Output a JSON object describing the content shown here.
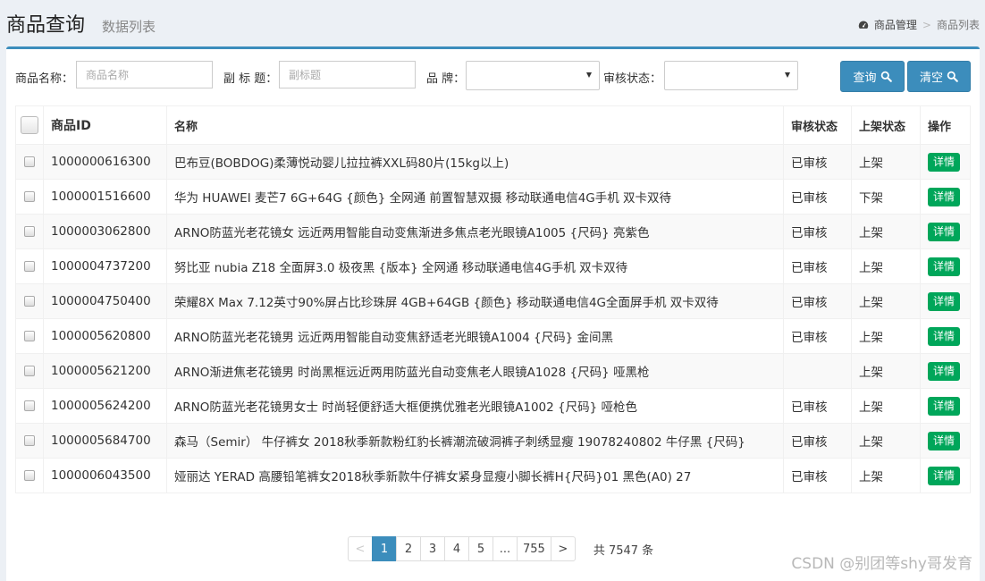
{
  "header": {
    "title": "商品查询",
    "subtitle": "数据列表",
    "breadcrumb": {
      "icon": "dashboard-icon",
      "root": "商品管理",
      "sep": ">",
      "current": "商品列表"
    }
  },
  "filters": {
    "name_label": "商品名称：",
    "name_placeholder": "商品名称",
    "subtitle_label": "副 标 题：",
    "subtitle_placeholder": "副标题",
    "brand_label": "品  牌：",
    "brand_value": "",
    "audit_label": "审核状态：",
    "audit_value": "",
    "query_button": "查询",
    "clear_button": "清空"
  },
  "table": {
    "columns": [
      "商品ID",
      "名称",
      "审核状态",
      "上架状态",
      "操作"
    ],
    "action_label": "详情",
    "rows": [
      {
        "id": "1000000616300",
        "name": "巴布豆(BOBDOG)柔薄悦动婴儿拉拉裤XXL码80片(15kg以上)",
        "audit": "已审核",
        "shelf": "上架"
      },
      {
        "id": "1000001516600",
        "name": "华为 HUAWEI 麦芒7 6G+64G {颜色} 全网通 前置智慧双摄 移动联通电信4G手机 双卡双待",
        "audit": "已审核",
        "shelf": "下架"
      },
      {
        "id": "1000003062800",
        "name": "ARNO防蓝光老花镜女 远近两用智能自动变焦渐进多焦点老光眼镜A1005 {尺码} 亮紫色",
        "audit": "已审核",
        "shelf": "上架"
      },
      {
        "id": "1000004737200",
        "name": "努比亚 nubia Z18 全面屏3.0 极夜黑 {版本} 全网通 移动联通电信4G手机 双卡双待",
        "audit": "已审核",
        "shelf": "上架"
      },
      {
        "id": "1000004750400",
        "name": "荣耀8X Max 7.12英寸90%屏占比珍珠屏 4GB+64GB {颜色} 移动联通电信4G全面屏手机 双卡双待",
        "audit": "已审核",
        "shelf": "上架"
      },
      {
        "id": "1000005620800",
        "name": "ARNO防蓝光老花镜男 远近两用智能自动变焦舒适老光眼镜A1004 {尺码} 金间黑",
        "audit": "已审核",
        "shelf": "上架"
      },
      {
        "id": "1000005621200",
        "name": "ARNO渐进焦老花镜男 时尚黑框远近两用防蓝光自动变焦老人眼镜A1028 {尺码} 哑黑枪",
        "audit": "",
        "shelf": "上架"
      },
      {
        "id": "1000005624200",
        "name": "ARNO防蓝光老花镜男女士 时尚轻便舒适大框便携优雅老光眼镜A1002 {尺码} 哑枪色",
        "audit": "已审核",
        "shelf": "上架"
      },
      {
        "id": "1000005684700",
        "name": "森马（Semir） 牛仔裤女 2018秋季新款粉红豹长裤潮流破洞裤子刺绣显瘦 19078240802 牛仔黑 {尺码}",
        "audit": "已审核",
        "shelf": "上架"
      },
      {
        "id": "1000006043500",
        "name": "娅丽达 YERAD 高腰铅笔裤女2018秋季新款牛仔裤女紧身显瘦小脚长裤H{尺码}01 黑色(A0) 27",
        "audit": "已审核",
        "shelf": "上架"
      }
    ]
  },
  "pagination": {
    "prev": "<",
    "pages": [
      "1",
      "2",
      "3",
      "4",
      "5",
      "...",
      "755"
    ],
    "active": "1",
    "next": ">",
    "total": "共 7547 条"
  },
  "watermark": "CSDN @别团等shy哥发育",
  "colors": {
    "primary": "#3c8dbc",
    "success": "#00a65a",
    "background": "#ecf0f5"
  }
}
